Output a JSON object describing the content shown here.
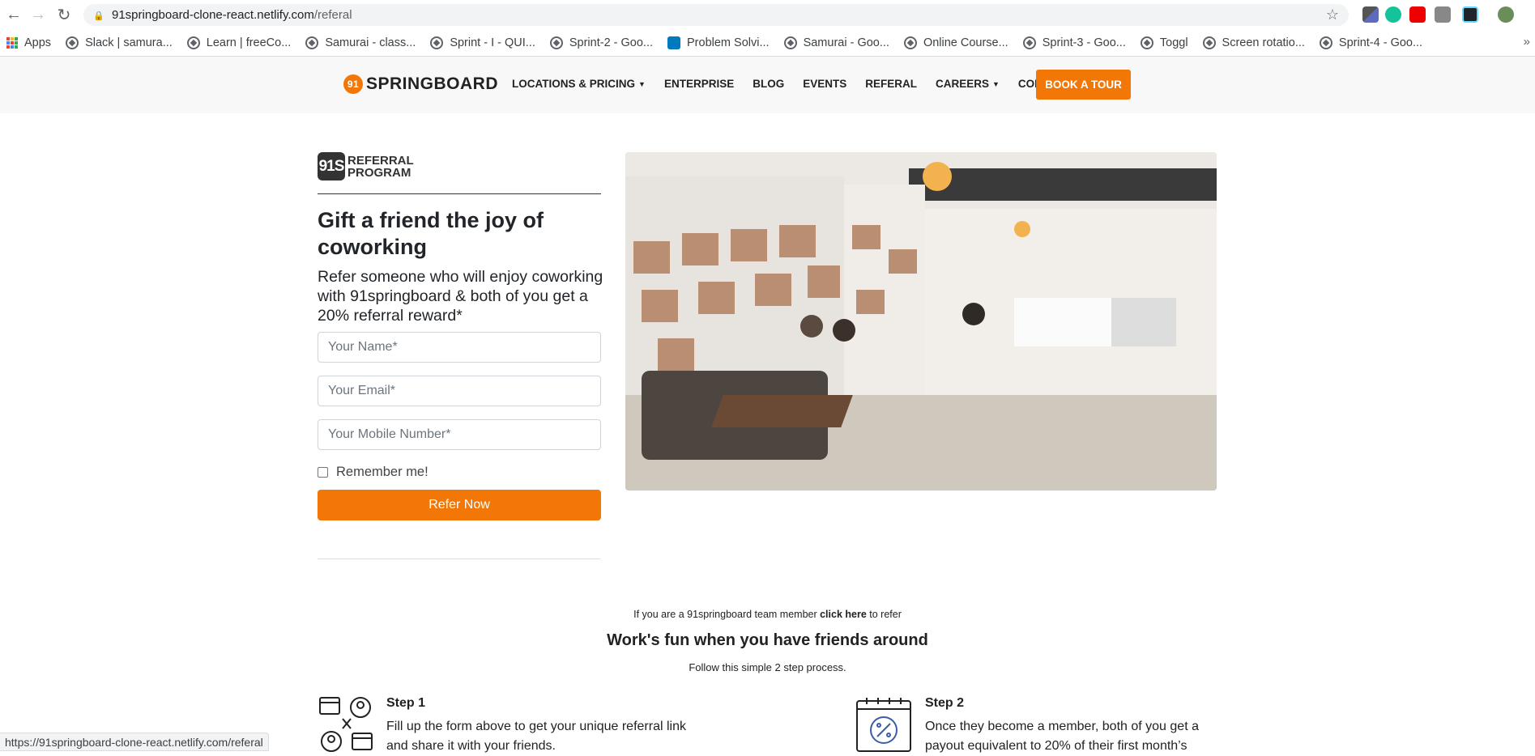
{
  "browser": {
    "url_host": "91springboard-clone-react.netlify.com",
    "url_path": "/referal",
    "bookmarks": [
      {
        "label": "Apps"
      },
      {
        "label": "Slack | samura..."
      },
      {
        "label": "Learn | freeCo..."
      },
      {
        "label": "Samurai - class..."
      },
      {
        "label": "Sprint - I - QUI..."
      },
      {
        "label": "Sprint-2 - Goo..."
      },
      {
        "label": "Problem Solvi..."
      },
      {
        "label": "Samurai - Goo..."
      },
      {
        "label": "Online Course..."
      },
      {
        "label": "Sprint-3 - Goo..."
      },
      {
        "label": "Toggl"
      },
      {
        "label": "Screen rotatio..."
      },
      {
        "label": "Sprint-4 - Goo..."
      }
    ],
    "bookmarks_more": "»",
    "status_url": "https://91springboard-clone-react.netlify.com/referal"
  },
  "header": {
    "logo_num": "91",
    "logo_text": "SPRINGBOARD",
    "menu": [
      {
        "label": "LOCATIONS & PRICING",
        "dropdown": true
      },
      {
        "label": "ENTERPRISE",
        "dropdown": false
      },
      {
        "label": "BLOG",
        "dropdown": false
      },
      {
        "label": "EVENTS",
        "dropdown": false
      },
      {
        "label": "REFERAL",
        "dropdown": false
      },
      {
        "label": "CAREERS",
        "dropdown": true
      },
      {
        "label": "CONTACT",
        "dropdown": true
      }
    ],
    "cta": "BOOK A TOUR"
  },
  "referral": {
    "badge_mark": "91S",
    "badge_line1": "REFERRAL",
    "badge_line2": "PROGRAM",
    "headline": "Gift a friend the joy of coworking",
    "subline": "Refer someone who will enjoy coworking with 91springboard & both of you get a 20% referral reward*",
    "name_placeholder": "Your Name*",
    "email_placeholder": "Your Email*",
    "mobile_placeholder": "Your Mobile Number*",
    "remember_label": "Remember me!",
    "submit_label": "Refer Now"
  },
  "lower": {
    "team_prefix": "If you are a 91springboard team member ",
    "team_link": "click here",
    "team_suffix": " to refer",
    "title": "Work's fun when you have friends around",
    "subtitle": "Follow this simple 2 step process.",
    "steps": [
      {
        "title": "Step 1",
        "text": "Fill up the form above to get your unique referral link and share it with your friends."
      },
      {
        "title": "Step 2",
        "text": "Once they become a member, both of you get a payout equivalent to 20% of their first month’s"
      }
    ]
  },
  "colors": {
    "accent": "#f27707",
    "text": "#212529"
  }
}
